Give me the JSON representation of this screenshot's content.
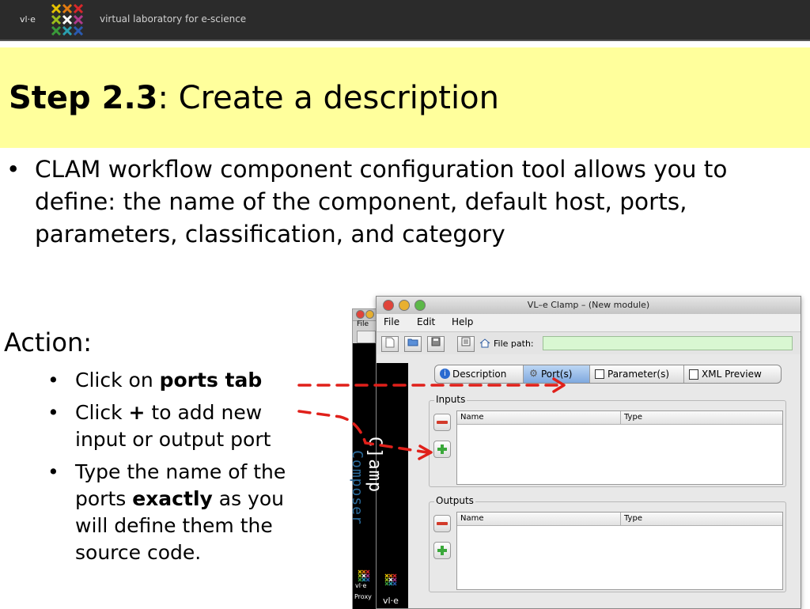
{
  "header": {
    "brand": "vl·e",
    "tagline": "virtual laboratory for e-science"
  },
  "slide": {
    "title_bold": "Step 2.3",
    "title_rest": ": Create a description",
    "main_bullet": "CLAM workflow component configuration tool allows you to define: the name of the component, default host, ports, parameters, classification, and category",
    "action_label": "Action:",
    "sub_bullets": [
      {
        "pre": "Click on ",
        "bold": "ports tab",
        "post": ""
      },
      {
        "pre": "Click ",
        "bold": "+",
        "post": " to add new input or output port"
      },
      {
        "pre": "Type the name of the ports ",
        "bold": "exactly",
        "post": " as you will define them the source code."
      }
    ]
  },
  "composer": {
    "menu_file": "File",
    "vertical_label": "Composer",
    "vle": "vl·e",
    "proxy": "Proxy"
  },
  "window": {
    "title": "VL–e Clamp – (New module)",
    "menus": [
      "File",
      "Edit",
      "Help"
    ],
    "file_path_label": "File path:",
    "file_path_value": "",
    "vertical_label": "C]amp",
    "vle": "vl·e",
    "tabs": [
      {
        "label": "Description",
        "icon": "info-icon",
        "selected": false
      },
      {
        "label": "Port(s)",
        "icon": "gear-icon",
        "selected": true
      },
      {
        "label": "Parameter(s)",
        "icon": "parameter-icon",
        "selected": false
      },
      {
        "label": "XML Preview",
        "icon": "document-icon",
        "selected": false
      }
    ],
    "inputs": {
      "label": "Inputs",
      "columns": [
        "Name",
        "Type"
      ]
    },
    "outputs": {
      "label": "Outputs",
      "columns": [
        "Name",
        "Type"
      ]
    }
  },
  "colors": {
    "title_band": "#ffff9c",
    "topbar": "#2b2b2b",
    "arrow": "#e0201a",
    "file_path_field": "#d9f7d2",
    "selected_tab": "#7fa9df"
  }
}
